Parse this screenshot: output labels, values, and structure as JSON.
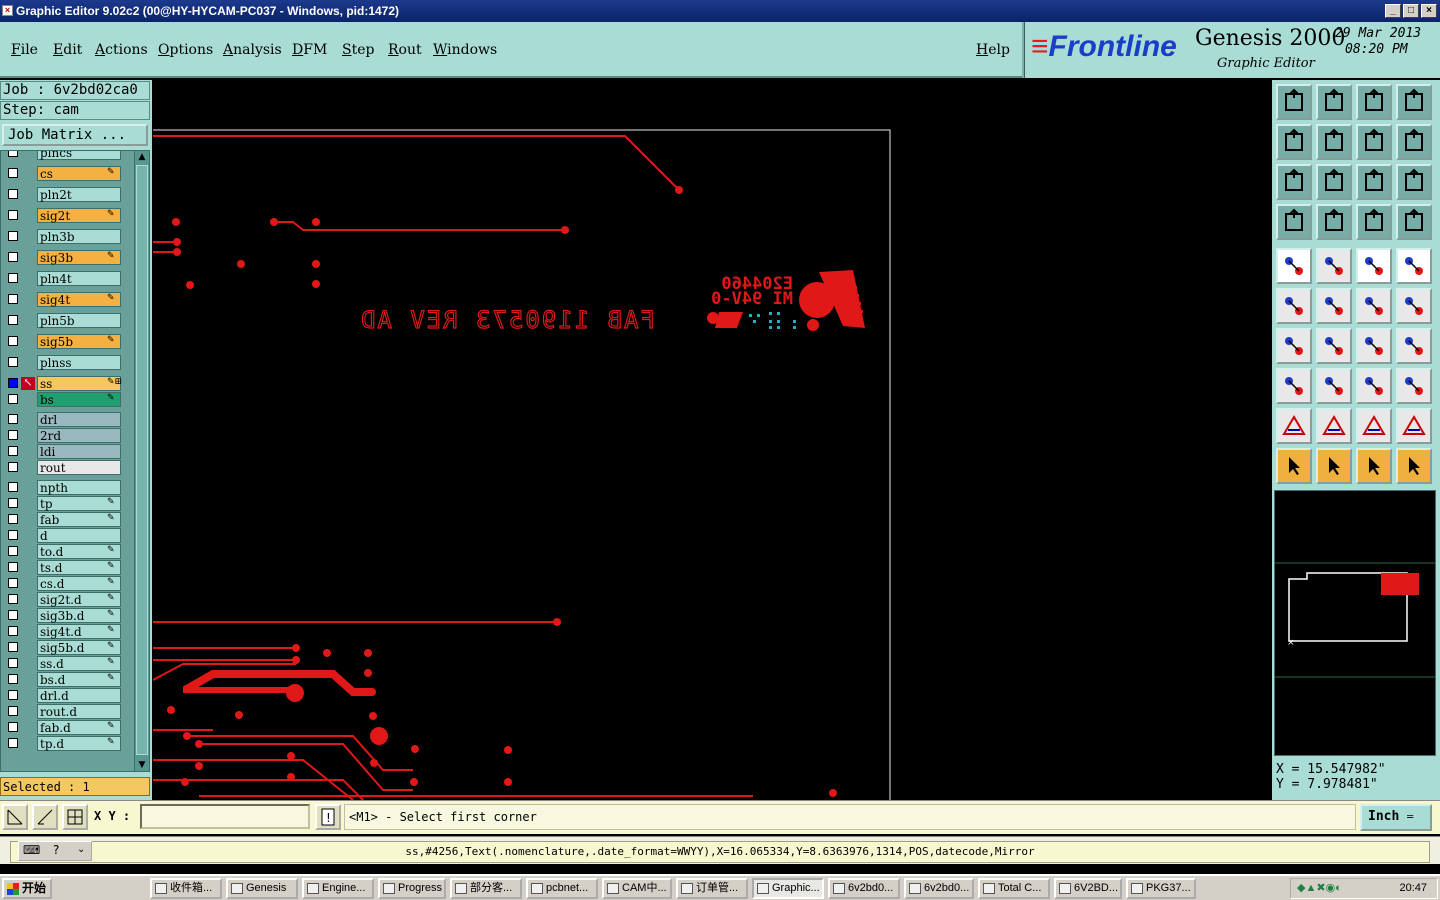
{
  "window": {
    "title": "Graphic Editor 9.02c2 (00@HY-HYCAM-PC037 - Windows, pid:1472)"
  },
  "menu": {
    "items": [
      "File",
      "Edit",
      "Actions",
      "Options",
      "Analysis",
      "DFM",
      "Step",
      "Rout",
      "Windows"
    ],
    "help": "Help"
  },
  "logo": {
    "brand": "Frontline",
    "product": "Genesis 2000",
    "subtitle": "Graphic Editor",
    "date": "29 Mar 2013",
    "time": "08:20 PM"
  },
  "job": {
    "job_line": "Job : 6v2bd02ca0",
    "step_line": "Step: cam",
    "matrix_button": "Job Matrix ..."
  },
  "layers": [
    {
      "name": "plncs",
      "color": "#a8dcd4",
      "mark": ""
    },
    {
      "name": "cs",
      "color": "#f4b040",
      "mark": "✎"
    },
    {
      "name": "pln2t",
      "color": "#a8dcd4",
      "mark": ""
    },
    {
      "name": "sig2t",
      "color": "#f4b040",
      "mark": "✎"
    },
    {
      "name": "pln3b",
      "color": "#a8dcd4",
      "mark": ""
    },
    {
      "name": "sig3b",
      "color": "#f4b040",
      "mark": "✎"
    },
    {
      "name": "pln4t",
      "color": "#a8dcd4",
      "mark": ""
    },
    {
      "name": "sig4t",
      "color": "#f4b040",
      "mark": "✎"
    },
    {
      "name": "pln5b",
      "color": "#a8dcd4",
      "mark": ""
    },
    {
      "name": "sig5b",
      "color": "#f4b040",
      "mark": "✎"
    },
    {
      "name": "plnss",
      "color": "#a8dcd4",
      "mark": ""
    },
    {
      "name": "ss",
      "color": "#f4c860",
      "mark": "✎⊞"
    },
    {
      "name": "bs",
      "color": "#20a070",
      "mark": "✎"
    },
    {
      "name": "drl",
      "color": "#9ab8c0",
      "mark": ""
    },
    {
      "name": "2rd",
      "color": "#9ab8c0",
      "mark": ""
    },
    {
      "name": "ldi",
      "color": "#9ab8c0",
      "mark": ""
    },
    {
      "name": "rout",
      "color": "#e8e8e8",
      "mark": ""
    },
    {
      "name": "npth",
      "color": "#a8dcd4",
      "mark": ""
    },
    {
      "name": "tp",
      "color": "#a8dcd4",
      "mark": "✎"
    },
    {
      "name": "fab",
      "color": "#a8dcd4",
      "mark": "✎"
    },
    {
      "name": "d",
      "color": "#a8dcd4",
      "mark": ""
    },
    {
      "name": "to.d",
      "color": "#a8dcd4",
      "mark": "✎"
    },
    {
      "name": "ts.d",
      "color": "#a8dcd4",
      "mark": "✎"
    },
    {
      "name": "cs.d",
      "color": "#a8dcd4",
      "mark": "✎"
    },
    {
      "name": "sig2t.d",
      "color": "#a8dcd4",
      "mark": "✎"
    },
    {
      "name": "sig3b.d",
      "color": "#a8dcd4",
      "mark": "✎"
    },
    {
      "name": "sig4t.d",
      "color": "#a8dcd4",
      "mark": "✎"
    },
    {
      "name": "sig5b.d",
      "color": "#a8dcd4",
      "mark": "✎"
    },
    {
      "name": "ss.d",
      "color": "#a8dcd4",
      "mark": "✎"
    },
    {
      "name": "bs.d",
      "color": "#a8dcd4",
      "mark": "✎"
    },
    {
      "name": "drl.d",
      "color": "#a8dcd4",
      "mark": ""
    },
    {
      "name": "rout.d",
      "color": "#a8dcd4",
      "mark": ""
    },
    {
      "name": "fab.d",
      "color": "#a8dcd4",
      "mark": "✎"
    },
    {
      "name": "tp.d",
      "color": "#a8dcd4",
      "mark": "✎"
    }
  ],
  "selected_text": "Selected : 1",
  "canvas": {
    "text_fab": "FAB 1190573  REV AD",
    "text_code": "E204460",
    "text_grade": "MI 94V-0"
  },
  "coords": {
    "x_line": "X = 15.547982\"",
    "y_line": "Y = 7.978481\""
  },
  "bottom": {
    "xy_label": "X Y :",
    "xy_value": "",
    "prompt": "<M1> - Select first corner",
    "unit": "Inch"
  },
  "status_line": "ss,#4256,Text(.nomenclature,.date_format=WWYY),X=16.065334,Y=8.6363976,1314,POS,datecode,Mirror",
  "taskbar": {
    "start": "开始",
    "tasks": [
      "收件箱...",
      "Genesis",
      "Engine...",
      "Progress",
      "部分客...",
      "pcbnet...",
      "CAM中...",
      "订单管...",
      "Graphic...",
      "6v2bd0...",
      "6v2bd0...",
      "Total C...",
      "6V2BD...",
      "PKG37..."
    ],
    "clock": "20:47"
  },
  "colors": {
    "panel": "#a8dcd4",
    "trace": "#e01818",
    "canvas": "#000000"
  }
}
